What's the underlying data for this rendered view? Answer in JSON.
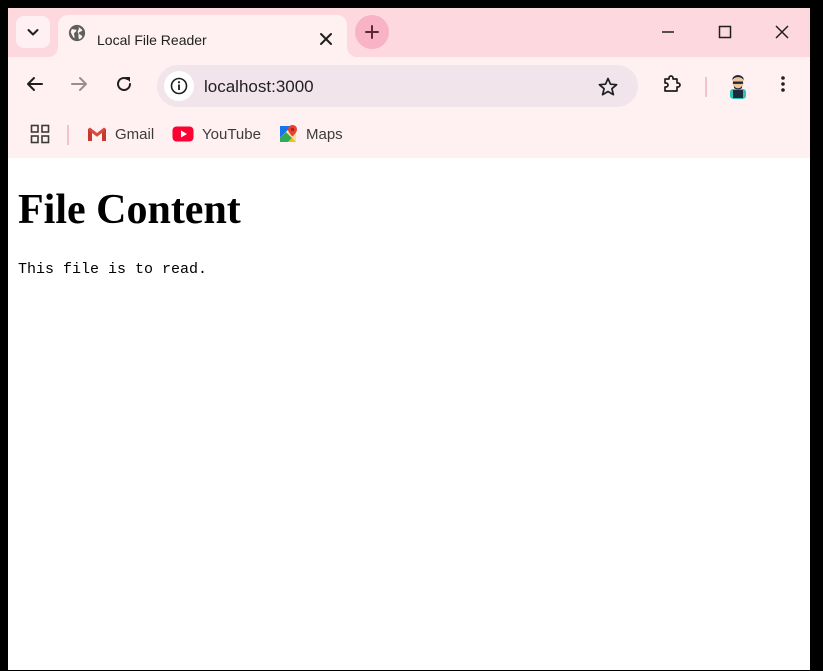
{
  "browser": {
    "tab": {
      "title": "Local File Reader",
      "favicon": "globe-icon"
    },
    "address_bar": {
      "url": "localhost:3000"
    },
    "bookmarks": [
      {
        "label": "Gmail",
        "icon": "gmail-icon"
      },
      {
        "label": "YouTube",
        "icon": "youtube-icon"
      },
      {
        "label": "Maps",
        "icon": "maps-icon"
      }
    ],
    "colors": {
      "tabstrip": "#fdd8df",
      "toolbar": "#fff0f1",
      "omnibox": "#f1e4ea",
      "new_tab": "#f8b3c6"
    }
  },
  "page": {
    "heading": "File Content",
    "file_text": "This file is to read."
  }
}
